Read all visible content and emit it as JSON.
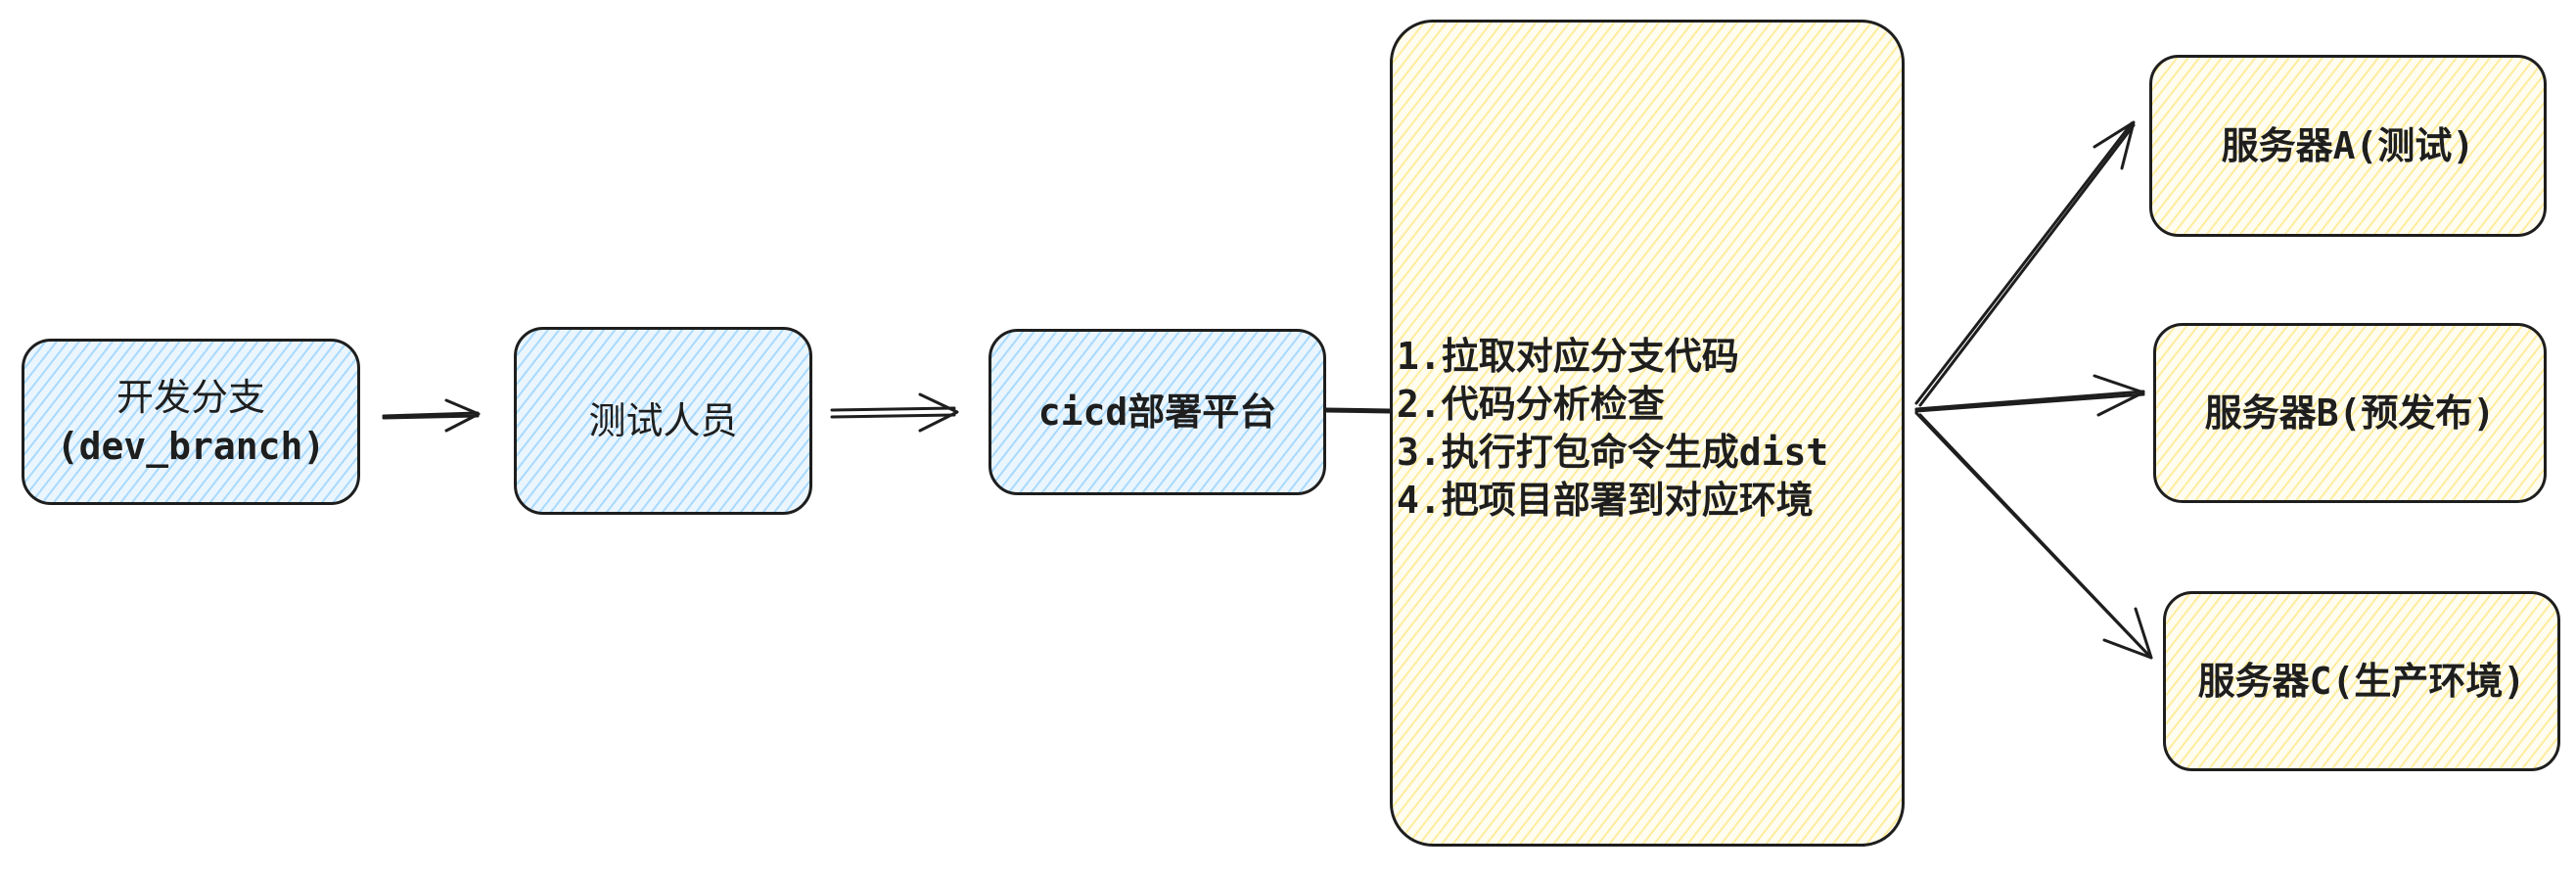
{
  "nodes": {
    "dev_branch": {
      "line1": "开发分支",
      "line2": "(dev_branch)"
    },
    "tester": {
      "label": "测试人员"
    },
    "cicd": {
      "label": "cicd部署平台"
    },
    "server_a": {
      "label": "服务器A(测试)"
    },
    "server_b": {
      "label": "服务器B(预发布)"
    },
    "server_c": {
      "label": "服务器C(生产环境)"
    }
  },
  "process_steps": [
    "1.拉取对应分支代码",
    "2.代码分析检查",
    "3.执行打包命令生成dist",
    "4.把项目部署到对应环境"
  ],
  "colors": {
    "stroke": "#1e1e1e",
    "blue_fill": "#a5d8ff",
    "yellow_fill": "#ffec99"
  }
}
